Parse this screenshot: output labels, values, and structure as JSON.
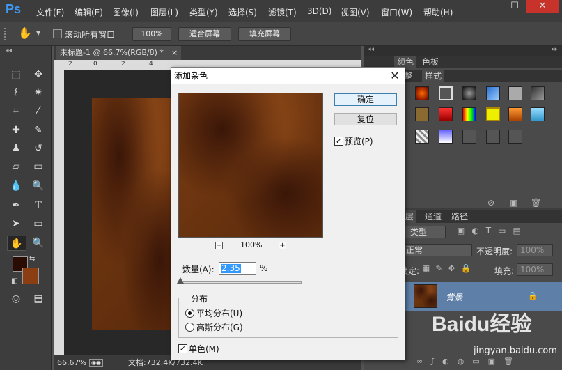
{
  "app": {
    "logo": "Ps"
  },
  "menu": [
    "文件(F)",
    "编辑(E)",
    "图像(I)",
    "图层(L)",
    "类型(Y)",
    "选择(S)",
    "滤镜(T)",
    "3D(D)",
    "视图(V)",
    "窗口(W)",
    "帮助(H)"
  ],
  "window_controls": {
    "minimize": "—",
    "maximize": "☐",
    "close": "✕"
  },
  "options_bar": {
    "scroll_all_label": "滚动所有窗口",
    "zoom_100": "100%",
    "fit_screen": "适合屏幕",
    "fill_screen": "填充屏幕"
  },
  "document": {
    "tab_title": "未标题-1 @ 66.7%(RGB/8) *",
    "tab_close": "×",
    "ruler_ticks": [
      "2",
      "0",
      "2",
      "4"
    ],
    "zoom": "66.67%",
    "doc_info": "文档:732.4K/732.4K"
  },
  "dialog": {
    "title": "添加杂色",
    "close": "✕",
    "ok": "确定",
    "reset": "复位",
    "preview_label": "预览(P)",
    "preview_checked": true,
    "preview_zoom": "100%",
    "zoom_minus": "−",
    "zoom_plus": "+",
    "amount_label": "数量(A):",
    "amount_value": "2.35",
    "amount_unit": "%",
    "distribution_title": "分布",
    "uniform_label": "平均分布(U)",
    "gaussian_label": "高斯分布(G)",
    "selected_distribution": "uniform",
    "mono_label": "单色(M)",
    "mono_checked": true
  },
  "panels": {
    "color_tabs": [
      "颜色",
      "色板"
    ],
    "style_tabs": [
      "整",
      "样式"
    ],
    "layer_tabs": [
      "层",
      "通道",
      "路径"
    ],
    "kind_filter": "类型",
    "blend_mode": "正常",
    "opacity_label": "不透明度:",
    "opacity_value": "100%",
    "lock_label": "锁定:",
    "fill_label": "填充:",
    "fill_value": "100%",
    "layer_name": "背景"
  },
  "colors": {
    "foreground": "#2b0c05",
    "background": "#8b3e12",
    "texture_dark": "#3a1608",
    "texture_mid": "#7a3c12",
    "accent_blue": "#3399ff"
  },
  "watermark": {
    "brand": "Baidu经验",
    "url": "jingyan.baidu.com"
  }
}
